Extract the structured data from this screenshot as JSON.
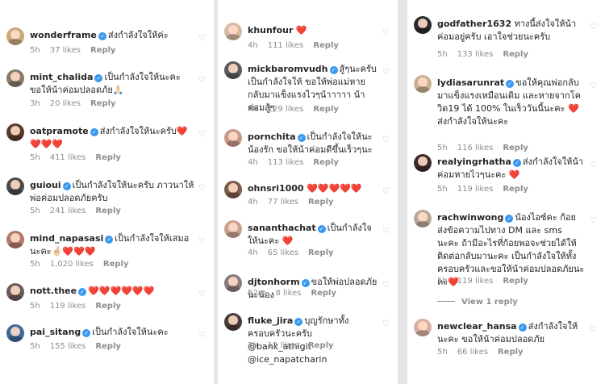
{
  "col1": [
    {
      "user": "wonderframe",
      "text": "ส่งกำลังใจให้ค่ะ",
      "time": "5h",
      "likes": "37 likes",
      "reply": "Reply",
      "color": "#c8a878"
    },
    {
      "user": "mint_chalida",
      "text": "เป็นกำลังใจให้นะคะ ขอให้น้าค่อมปลอดภัย🙏🏻",
      "time": "3h",
      "likes": "20 likes",
      "reply": "Reply",
      "color": "#8a7a6a"
    },
    {
      "user": "oatpramote",
      "text": "ส่งกำลังใจให้นะครับ❤️❤️❤️❤️",
      "time": "5h",
      "likes": "411 likes",
      "reply": "Reply",
      "color": "#5a3a2a"
    },
    {
      "user": "guioui",
      "text": "เป็นกำลังใจให้นะครับ ภาวนาให้พ่อค่อมปลอดภัยครับ",
      "time": "5h",
      "likes": "241 likes",
      "reply": "Reply",
      "color": "#4a4a4a"
    },
    {
      "user": "mind_napasasi",
      "text": "เป็นกำลังใจให้เสมอนะคะ🤞🏻❤️❤️❤️",
      "time": "5h",
      "likes": "1,020 likes",
      "reply": "Reply",
      "color": "#b07a6a"
    },
    {
      "user": "nott.thee",
      "text": "❤️❤️❤️❤️❤️❤️",
      "time": "5h",
      "likes": "119 likes",
      "reply": "Reply",
      "color": "#6a5a5a"
    },
    {
      "user": "pai_sitang",
      "text": "เป็นกำลังใจให้นะคะ",
      "time": "5h",
      "likes": "155 likes",
      "reply": "Reply",
      "color": "#3a6a9a"
    }
  ],
  "col2": [
    {
      "user": "khunfour",
      "text": "❤️",
      "time": "4h",
      "likes": "111 likes",
      "reply": "Reply",
      "color": "#d8b8a0"
    },
    {
      "user": "mickbaromvudh",
      "text": "สู้ๆนะครับ เป็นกำลังใจให้ ขอให้พ่อแม่หายกลับมาแข็งแรงไวๆน้าาาาา น้าค่อมสู้ๆ",
      "time": "4h",
      "likes": "129 likes",
      "reply": "Reply",
      "color": "#5a5a5a"
    },
    {
      "user": "pornchita",
      "text": "เป็นกำลังใจให้นะน้องรัก ขอให้น้าค่อมดีขึ้นเร็วๆนะ",
      "time": "4h",
      "likes": "113 likes",
      "reply": "Reply",
      "color": "#c89888"
    },
    {
      "user": "ohnsri1000",
      "text": "❤️❤️❤️❤️❤️",
      "time": "4h",
      "likes": "77 likes",
      "reply": "Reply",
      "color": "#7a5a4a"
    },
    {
      "user": "sananthachat",
      "text": "เป็นกำลังใจให้นะคะ ❤️",
      "time": "4h",
      "likes": "65 likes",
      "reply": "Reply",
      "color": "#c8a090"
    },
    {
      "user": "djtonhorm",
      "text": "ขอให้พ่อปลอดภัยนะน้อง",
      "time": "52m",
      "likes": "8 likes",
      "reply": "Reply",
      "color": "#8a7a7a"
    },
    {
      "user": "fluke_jira",
      "text": "บุญรักษาทั้งครอบครัวนะครับ @bank_athigit @ice_napatcharin",
      "time": "2h",
      "likes": "12 likes",
      "reply": "Reply",
      "color": "#4a3a3a"
    }
  ],
  "col3": [
    {
      "user": "godfather1632",
      "text": "ทางนี้ส่งใจให้น้าค่อมอยู่ครับ เอาใจช่วยนะครับ",
      "time": "5h",
      "likes": "133 likes",
      "reply": "Reply",
      "color": "#2a2a2a"
    },
    {
      "user": "lydiasarunrat",
      "text": "ขอให้คุณพ่อกลับมาแข็งแรงเหมือนเดิม และหายจากโควิด19 ได้ 100% ในเร็ววันนี้นะคะ ❤️ ส่งกำลังใจให้นะคะ",
      "time": "5h",
      "likes": "116 likes",
      "reply": "Reply",
      "color": "#c8b090"
    },
    {
      "user": "realyingrhatha",
      "text": "ส่งกำลังใจให้น้าค่อมหายไวๆนะคะ ❤️",
      "time": "5h",
      "likes": "119 likes",
      "reply": "Reply",
      "color": "#3a2a2a"
    },
    {
      "user": "rachwinwong",
      "text": "น้องไอซ์คะ ก้อยส่งข้อความไปทาง DM และ sms นะคะ ถ้ามีอะไรที่ก้อยพอจะช่วยได้ให้ติดต่อกลับมานะคะ เป็นกำลังใจให้ทั้งครอบครัวและขอให้น้าค่อมปลอดภัยนะคะ❤️",
      "time": "5h",
      "likes": "119 likes",
      "reply": "Reply",
      "color": "#b8a898",
      "view_replies": "View 1 reply"
    },
    {
      "user": "newclear_hansa",
      "text": "ส่งกำลังใจให้นะคะ ขอให้น้าค่อมปลอดภัย",
      "time": "5h",
      "likes": "66 likes",
      "reply": "Reply",
      "color": "#d8b0a0"
    }
  ],
  "heart_icon": "♡",
  "verified_icon": "✓"
}
